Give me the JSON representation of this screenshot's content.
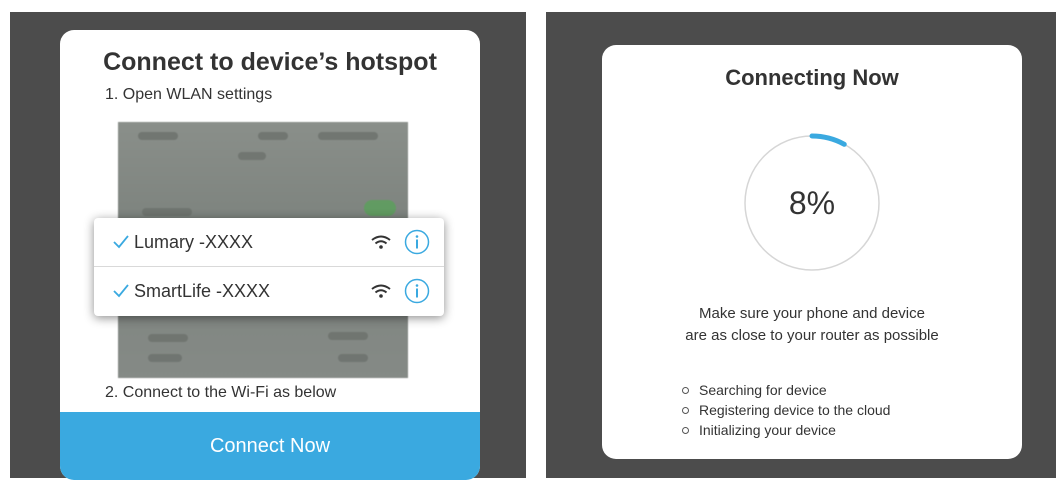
{
  "left_card": {
    "title": "Connect to device’s hotspot",
    "step1": "1. Open WLAN settings",
    "step2": "2. Connect to the Wi-Fi as below",
    "networks": [
      {
        "name": "Lumary -XXXX"
      },
      {
        "name": "SmartLife -XXXX"
      }
    ],
    "button_label": "Connect Now"
  },
  "right_card": {
    "title": "Connecting Now",
    "progress_label": "8%",
    "progress_value": 0.08,
    "tip_line1": "Make sure your phone and device",
    "tip_line2": "are as close to your router as possible",
    "status_items": [
      "Searching for device",
      "Registering device to the cloud",
      "Initializing your device"
    ]
  },
  "colors": {
    "accent": "#3aa9e0",
    "backdrop": "#4c4c4c",
    "ring_track": "#d6d6d6"
  },
  "icons": [
    "check-icon",
    "wifi-signal-icon",
    "info-icon",
    "bullet-icon"
  ]
}
